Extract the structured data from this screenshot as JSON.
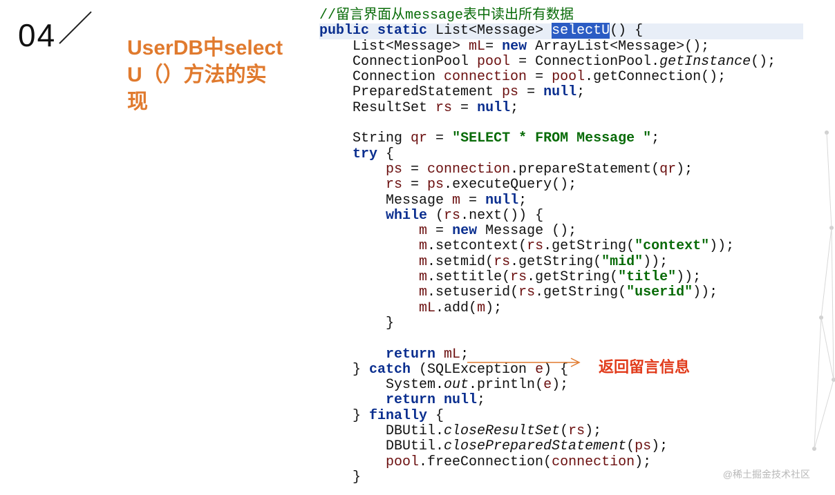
{
  "slide_number": "04",
  "title": "UserDB中selectU（）方法的实现",
  "code": {
    "comment": "//留言界面从message表中读出所有数据",
    "l1_a": "public",
    "l1_b": "static",
    "l1_c": " List<Message> ",
    "l1_sel": "selectU",
    "l1_d": "() {",
    "l2_a": "    List<Message> ",
    "l2_v": "mL",
    "l2_b": "= ",
    "l2_kw": "new",
    "l2_c": " ArrayList<Message>();",
    "l3_a": "    ConnectionPool ",
    "l3_v": "pool",
    "l3_b": " = ConnectionPool.",
    "l3_it": "getInstance",
    "l3_c": "();",
    "l4_a": "    Connection ",
    "l4_v": "connection",
    "l4_b": " = ",
    "l4_v2": "pool",
    "l4_c": ".getConnection();",
    "l5_a": "    PreparedStatement ",
    "l5_v": "ps",
    "l5_b": " = ",
    "l5_kw": "null",
    "l5_c": ";",
    "l6_a": "    ResultSet ",
    "l6_v": "rs",
    "l6_b": " = ",
    "l6_kw": "null",
    "l6_c": ";",
    "l7": "",
    "l8_a": "    String ",
    "l8_v": "qr",
    "l8_b": " = ",
    "l8_str": "\"SELECT * FROM Message \"",
    "l8_c": ";",
    "l9_a": "    ",
    "l9_kw": "try",
    "l9_b": " {",
    "l10_a": "        ",
    "l10_v": "ps",
    "l10_b": " = ",
    "l10_v2": "connection",
    "l10_c": ".prepareStatement(",
    "l10_v3": "qr",
    "l10_d": ");",
    "l11_a": "        ",
    "l11_v": "rs",
    "l11_b": " = ",
    "l11_v2": "ps",
    "l11_c": ".executeQuery();",
    "l12_a": "        Message ",
    "l12_v": "m",
    "l12_b": " = ",
    "l12_kw": "null",
    "l12_c": ";",
    "l13_a": "        ",
    "l13_kw": "while",
    "l13_b": " (",
    "l13_v": "rs",
    "l13_c": ".next()) {",
    "l14_a": "            ",
    "l14_v": "m",
    "l14_b": " = ",
    "l14_kw": "new",
    "l14_c": " Message ();",
    "l15_a": "            ",
    "l15_v": "m",
    "l15_b": ".setcontext(",
    "l15_v2": "rs",
    "l15_c": ".getString(",
    "l15_str": "\"context\"",
    "l15_d": "));",
    "l16_a": "            ",
    "l16_v": "m",
    "l16_b": ".setmid(",
    "l16_v2": "rs",
    "l16_c": ".getString(",
    "l16_str": "\"mid\"",
    "l16_d": "));",
    "l17_a": "            ",
    "l17_v": "m",
    "l17_b": ".settitle(",
    "l17_v2": "rs",
    "l17_c": ".getString(",
    "l17_str": "\"title\"",
    "l17_d": "));",
    "l18_a": "            ",
    "l18_v": "m",
    "l18_b": ".setuserid(",
    "l18_v2": "rs",
    "l18_c": ".getString(",
    "l18_str": "\"userid\"",
    "l18_d": "));",
    "l19_a": "            ",
    "l19_v": "mL",
    "l19_b": ".add(",
    "l19_v2": "m",
    "l19_c": ");",
    "l20": "        }",
    "l21": "",
    "l22_a": "        ",
    "l22_kw": "return",
    "l22_b": " ",
    "l22_v": "mL",
    "l22_c": ";",
    "l23_a": "    } ",
    "l23_kw": "catch",
    "l23_b": " (SQLException ",
    "l23_v": "e",
    "l23_c": ") {",
    "l24_a": "        System.",
    "l24_it": "out",
    "l24_b": ".println(",
    "l24_v": "e",
    "l24_c": ");",
    "l25_a": "        ",
    "l25_kw": "return null",
    "l25_b": ";",
    "l26_a": "    } ",
    "l26_kw": "finally",
    "l26_b": " {",
    "l27_a": "        DBUtil.",
    "l27_it": "closeResultSet",
    "l27_b": "(",
    "l27_v": "rs",
    "l27_c": ");",
    "l28_a": "        DBUtil.",
    "l28_it": "closePreparedStatement",
    "l28_b": "(",
    "l28_v": "ps",
    "l28_c": ");",
    "l29_a": "        ",
    "l29_v": "pool",
    "l29_b": ".freeConnection(",
    "l29_v2": "connection",
    "l29_c": ");",
    "l30": "    }"
  },
  "annotation": "返回留言信息",
  "watermark": "@稀土掘金技术社区"
}
